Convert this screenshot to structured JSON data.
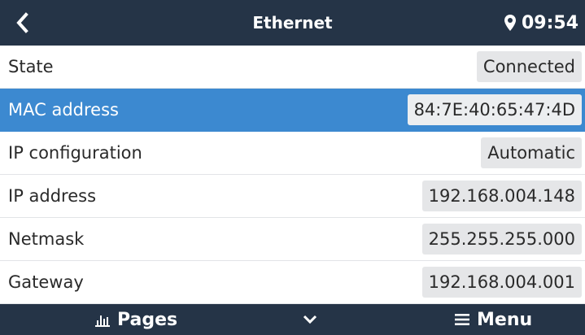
{
  "header": {
    "back_icon": "chevron-left-icon",
    "title": "Ethernet",
    "location_icon": "location-pin-icon",
    "time": "09:54"
  },
  "rows": [
    {
      "label": "State",
      "value": "Connected"
    },
    {
      "label": "MAC address",
      "value": "84:7E:40:65:47:4D",
      "selected": true
    },
    {
      "label": "IP configuration",
      "value": "Automatic"
    },
    {
      "label": "IP address",
      "value": "192.168.004.148"
    },
    {
      "label": "Netmask",
      "value": "255.255.255.000"
    },
    {
      "label": "Gateway",
      "value": "192.168.004.001"
    }
  ],
  "footer": {
    "pages_icon": "bar-chart-icon",
    "pages_label": "Pages",
    "center_icon": "chevron-down-icon",
    "menu_icon": "hamburger-menu-icon",
    "menu_label": "Menu"
  },
  "colors": {
    "header_bg": "#253447",
    "selected_row_bg": "#3c89d0",
    "value_bg": "#e5e6e8"
  }
}
